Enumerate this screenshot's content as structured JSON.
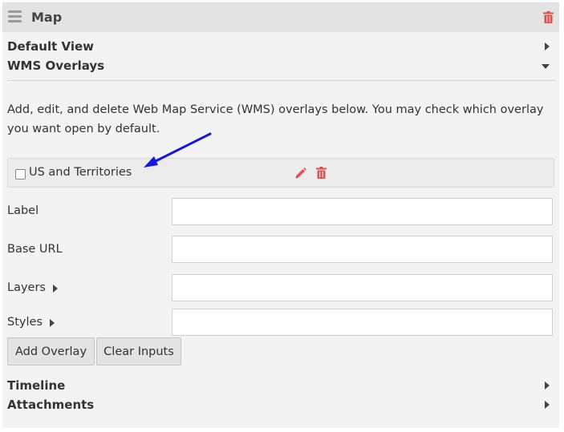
{
  "header": {
    "title": "Map",
    "menu_icon": "hamburger-icon",
    "delete_icon": "trash-icon"
  },
  "sections": {
    "default_view": "Default View",
    "wms_overlays": "WMS Overlays",
    "timeline": "Timeline",
    "attachments": "Attachments"
  },
  "wms": {
    "description": "Add, edit, and delete Web Map Service (WMS) overlays below. You may check which overlay you want open by default.",
    "overlays": [
      {
        "label": "US and Territories",
        "checked": false
      }
    ],
    "form": {
      "label_label": "Label",
      "base_url_label": "Base URL",
      "layers_label": "Layers",
      "styles_label": "Styles",
      "label_value": "",
      "base_url_value": "",
      "layers_value": "",
      "styles_value": ""
    },
    "buttons": {
      "add": "Add Overlay",
      "clear": "Clear Inputs"
    }
  },
  "colors": {
    "accent_red": "#d9534f",
    "annotation_arrow": "#1515e6"
  }
}
